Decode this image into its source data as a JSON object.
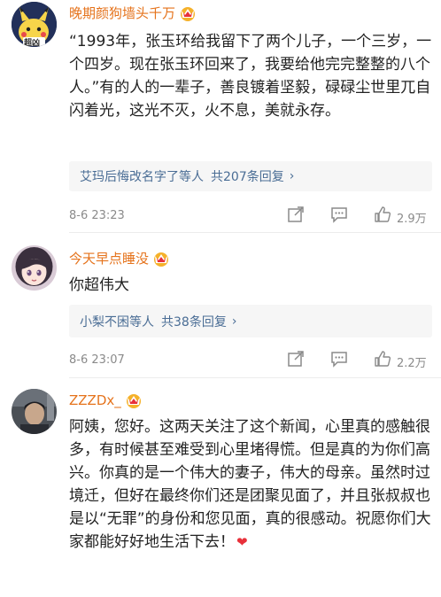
{
  "comments": [
    {
      "username": "晚期颜狗墙头千万",
      "avatar_badge": "超凶",
      "text": "“1993年，张玉环给我留下了两个儿子，一个三岁，一个四岁。现在张玉环回来了，我要给他完完整整的八个人。”有的人的一辈子，善良镀着坚毅，碌碌尘世里兀自闪着光，这光不灭，火不息，美就永存。",
      "replies_users": "艾玛后悔改名字了等人",
      "replies_count": "共207条回复",
      "time": "8-6 23:23",
      "likes": "2.9万"
    },
    {
      "username": "今天早点睡没",
      "text": "你超伟大",
      "replies_users": "小梨不困等人",
      "replies_count": "共38条回复",
      "time": "8-6 23:07",
      "likes": "2.2万"
    },
    {
      "username": "ZZZDx_",
      "text": "阿姨，您好。这两天关注了这个新闻，心里真的感触很多，有时候甚至难受到心里堵得慌。但是真的为你们高兴。你真的是一个伟大的妻子，伟大的母亲。虽然时过境迁，但好在最终你们还是团聚见面了，并且张叔叔也是以“无罪”的身份和您见面，真的很感动。祝愿你们大家都能好好地生活下去！",
      "emoji": "❤"
    }
  ],
  "colors": {
    "username": "#e5731c",
    "reply_link": "#4a6d95",
    "meta": "#8a8a8a",
    "heart": "#e8303a"
  },
  "icons": [
    "vip-crown-icon",
    "share-icon",
    "comment-icon",
    "like-icon",
    "chevron-right-icon"
  ]
}
